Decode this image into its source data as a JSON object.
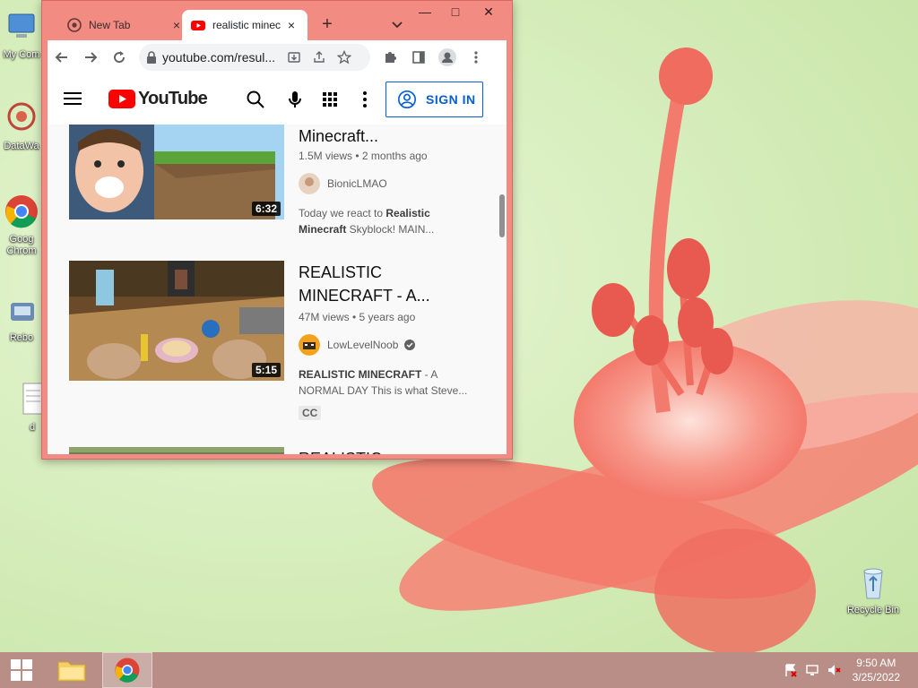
{
  "desktop": {
    "icons": [
      {
        "label": "My Com"
      },
      {
        "label": "DataWa"
      },
      {
        "label": "Goog Chrom"
      },
      {
        "label": "Rebo"
      },
      {
        "label": "d"
      },
      {
        "label": "Recycle Bin"
      }
    ]
  },
  "browser": {
    "tabs": [
      {
        "label": "New Tab",
        "close": "×"
      },
      {
        "label": "realistic minec",
        "close": "×"
      }
    ],
    "new_tab": "+",
    "window_controls": {
      "minimize": "—",
      "maximize": "□",
      "close": "✕"
    },
    "url": "youtube.com/resul..."
  },
  "youtube": {
    "logo_text": "YouTube",
    "sign_in": "SIGN IN",
    "videos": [
      {
        "title": "Minecraft...",
        "meta": "1.5M views • 2 months ago",
        "channel": "BionicLMAO",
        "verified": false,
        "desc_bold_1": "",
        "desc_1": "Today we react to ",
        "desc_bold_2": "Realistic",
        "desc_bold_3": "Minecraft",
        "desc_2": " Skyblock! MAIN...",
        "duration": "6:32"
      },
      {
        "title_line1": "REALISTIC",
        "title_line2": "MINECRAFT - A...",
        "meta": "47M views • 5 years ago",
        "channel": "LowLevelNoob",
        "verified": true,
        "desc_bold": "REALISTIC MINECRAFT",
        "desc_1": " - A",
        "desc_2": "NORMAL DAY This is what Steve...",
        "badge": "CC",
        "duration": "5:15"
      },
      {
        "title_partial": "REALISTIC"
      }
    ]
  },
  "taskbar": {
    "clock_time": "9:50 AM",
    "clock_date": "3/25/2022"
  },
  "colors": {
    "window_frame": "#f28b82",
    "taskbar": "#b88e86",
    "yt_red": "#ff0000",
    "link_blue": "#065fd4"
  }
}
